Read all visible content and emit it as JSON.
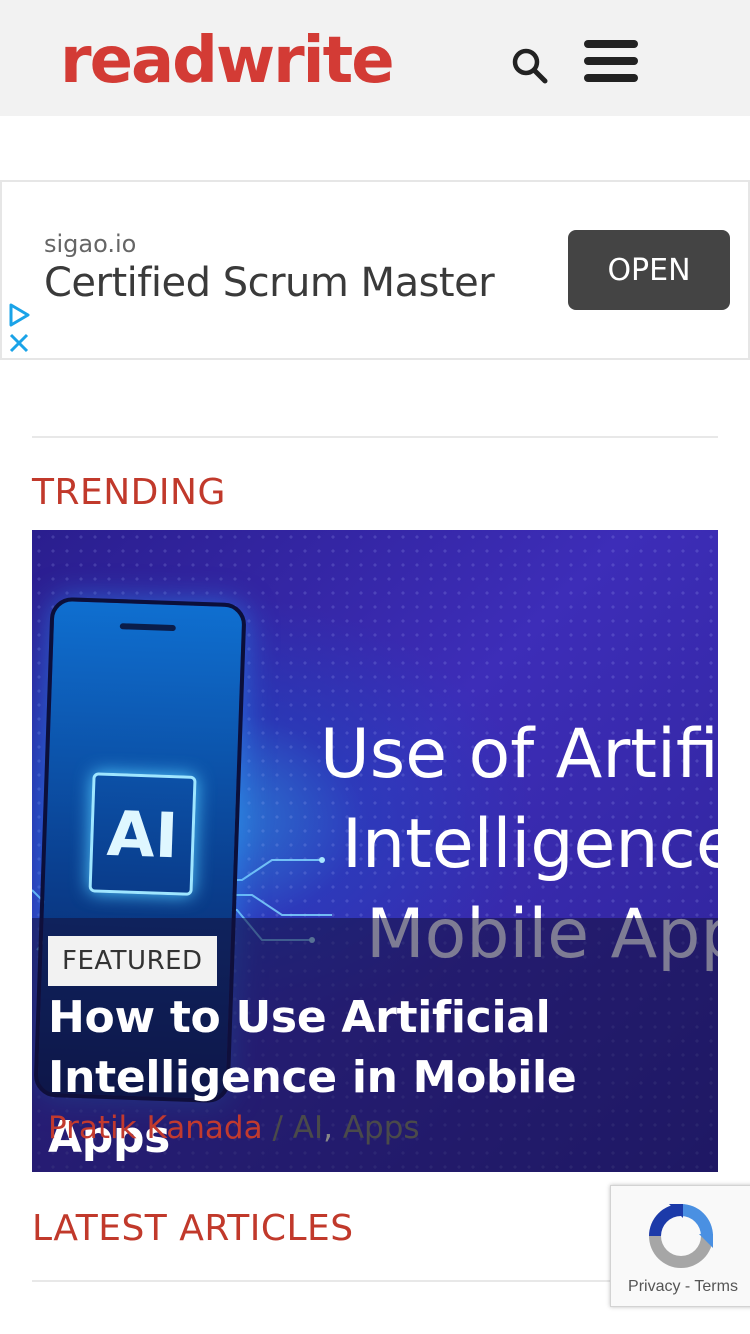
{
  "header": {
    "logo": "readwrite"
  },
  "ad": {
    "domain": "sigao.io",
    "title": "Certified Scrum Master",
    "button": "OPEN"
  },
  "trending": {
    "heading": "TRENDING",
    "card": {
      "badge": "FEATURED",
      "image_text": [
        "Use of Artifi",
        "Intelligence",
        "Mobile App"
      ],
      "image_chip_text": "AI",
      "title": "How to Use Artificial Intelligence in Mobile Apps",
      "author": "Pratik Kanada",
      "separator": "/",
      "categories": [
        "AI",
        "Apps"
      ],
      "category_separator": ","
    }
  },
  "latest": {
    "heading": "LATEST ARTICLES"
  },
  "recaptcha": {
    "privacy": "Privacy",
    "dash": "-",
    "terms": "Terms"
  },
  "colors": {
    "brand": "#d33b35",
    "section_heading": "#c1392b",
    "ad_button": "#444444"
  }
}
